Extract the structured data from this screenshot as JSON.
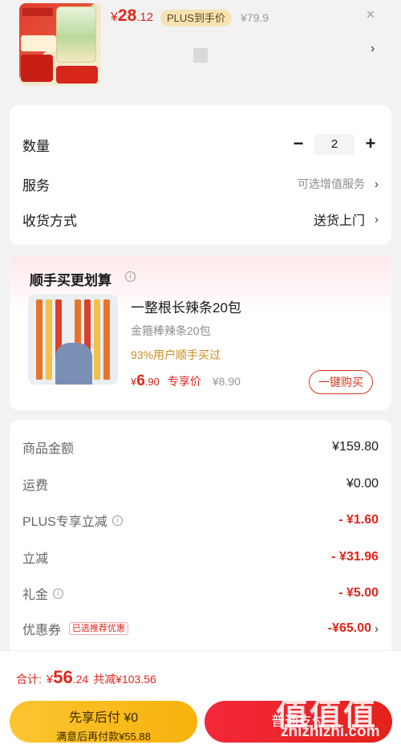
{
  "product": {
    "price_currency": "¥",
    "price_int": "28",
    "price_dec": ".12",
    "plus_badge": "PLUS到手价",
    "original_price": "¥79.9",
    "close_symbol": "×",
    "chevron": "›"
  },
  "options": {
    "quantity_label": "数量",
    "minus": "−",
    "quantity_value": "2",
    "plus": "+",
    "service_label": "服务",
    "service_value": "可选增值服务",
    "delivery_label": "收货方式",
    "delivery_value": "送货上门",
    "chevron": "›"
  },
  "addon": {
    "title": "顺手买更划算",
    "info_symbol": "i",
    "name": "一整根长辣条20包",
    "subtitle": "金箍棒辣条20包",
    "percent_text": "93%用户顺手买过",
    "price_currency": "¥",
    "price_int": "6",
    "price_dec": ".90",
    "price_tag": "专享价",
    "original_price": "¥8.90",
    "buy_button": "一键购买"
  },
  "summary": {
    "rows": [
      {
        "label": "商品金额",
        "value": "¥159.80"
      },
      {
        "label": "运费",
        "value": "¥0.00"
      },
      {
        "label": "PLUS专享立减",
        "value": "- ¥1.60"
      },
      {
        "label": "立减",
        "value": "- ¥31.96"
      },
      {
        "label": "礼金",
        "value": "- ¥5.00"
      },
      {
        "label": "优惠券",
        "value": "-¥65.00",
        "badge": "已选推荐优惠"
      }
    ],
    "chevron": "›",
    "info_symbol": "i"
  },
  "footer": {
    "total_label": "合计:",
    "total_currency": "¥",
    "total_int": "56",
    "total_dec": ".24",
    "savings": "共减¥103.56",
    "later_line1": "先享后付 ¥0",
    "later_line2": "满意后再付款¥55.88",
    "pay_button": "普通支付"
  },
  "watermark": {
    "logo": "值值值",
    "site": "zhizhizhi.com"
  },
  "colors": {
    "accent_red": "#e1251b",
    "plus_gold": "#f6e3b2",
    "later_yellow": "#fbc531",
    "background": "#f2f2f2"
  }
}
